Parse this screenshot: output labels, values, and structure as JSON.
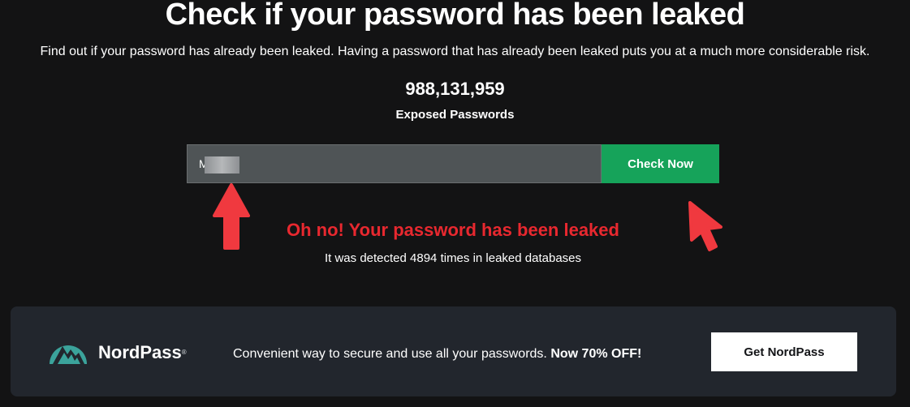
{
  "header": {
    "title": "Check if your password has been leaked",
    "subtitle": "Find out if your password has already been leaked. Having a password that has already been leaked puts you at a much more considerable risk."
  },
  "stats": {
    "exposed_count": "988,131,959",
    "exposed_label": "Exposed Passwords"
  },
  "checker": {
    "input_value": "M      23",
    "button_label": "Check Now"
  },
  "result": {
    "title": "Oh no! Your password has been leaked",
    "detail": "It was detected 4894 times in leaked databases"
  },
  "promo": {
    "brand": "NordPass",
    "brand_mark": "®",
    "text": "Convenient way to secure and use all your passwords.",
    "offer": "Now 70% OFF!",
    "button_label": "Get NordPass"
  },
  "colors": {
    "background": "#131314",
    "accent_green": "#16a35a",
    "alert_red": "#e8282f",
    "promo_bg": "#22262d",
    "nordpass_teal": "#3ba39b"
  },
  "icons": {
    "annotation_arrow_up": "arrow-up-icon",
    "annotation_cursor": "cursor-arrow-icon",
    "brand_logo": "nordpass-logo-icon"
  }
}
